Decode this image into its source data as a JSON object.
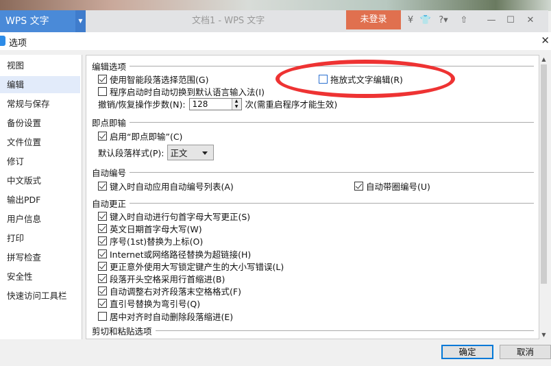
{
  "app": {
    "name": "WPS 文字",
    "doc_title": "文档1 - WPS 文字",
    "login": "未登录"
  },
  "dialog": {
    "title": "选项",
    "ok": "确定",
    "cancel": "取消"
  },
  "sidebar": {
    "selected": 1,
    "items": [
      "视图",
      "编辑",
      "常规与保存",
      "备份设置",
      "文件位置",
      "修订",
      "中文版式",
      "输出PDF",
      "用户信息",
      "打印",
      "拼写检查",
      "安全性",
      "快速访问工具栏"
    ]
  },
  "edit": {
    "section": "编辑选项",
    "smart_select": {
      "label": "使用智能段落选择范围(G)",
      "checked": true
    },
    "drag_drop": {
      "label": "拖放式文字编辑(R)",
      "checked": false
    },
    "auto_ime": {
      "label": "程序启动时自动切换到默认语言输入法(I)",
      "checked": false
    },
    "undo_label": "撤销/恢复操作步数(N):",
    "undo_value": "128",
    "undo_note": "次(需重启程序才能生效)"
  },
  "click_type": {
    "section": "即点即输",
    "enable": {
      "label": "启用“即点即输”(C)",
      "checked": true
    },
    "style_label": "默认段落样式(P):",
    "style_value": "正文"
  },
  "auto_number": {
    "section": "自动编号",
    "list": {
      "label": "键入时自动应用自动编号列表(A)",
      "checked": true
    },
    "circle": {
      "label": "自动带圈编号(U)",
      "checked": true
    }
  },
  "autocorrect": {
    "section": "自动更正",
    "items": [
      {
        "label": "键入时自动进行句首字母大写更正(S)",
        "checked": true
      },
      {
        "label": "英文日期首字母大写(W)",
        "checked": true
      },
      {
        "label": "序号(1st)替换为上标(O)",
        "checked": true
      },
      {
        "label": "Internet或网络路径替换为超链接(H)",
        "checked": true
      },
      {
        "label": "更正意外使用大写锁定键产生的大小写错误(L)",
        "checked": true
      },
      {
        "label": "段落开头空格采用行首缩进(B)",
        "checked": true
      },
      {
        "label": "自动调整右对齐段落末空格格式(F)",
        "checked": true
      },
      {
        "label": "直引号替换为弯引号(Q)",
        "checked": true
      },
      {
        "label": "居中对齐时自动删除段落缩进(E)",
        "checked": false
      }
    ]
  },
  "cut_paste": {
    "section": "剪切和粘贴选项"
  }
}
